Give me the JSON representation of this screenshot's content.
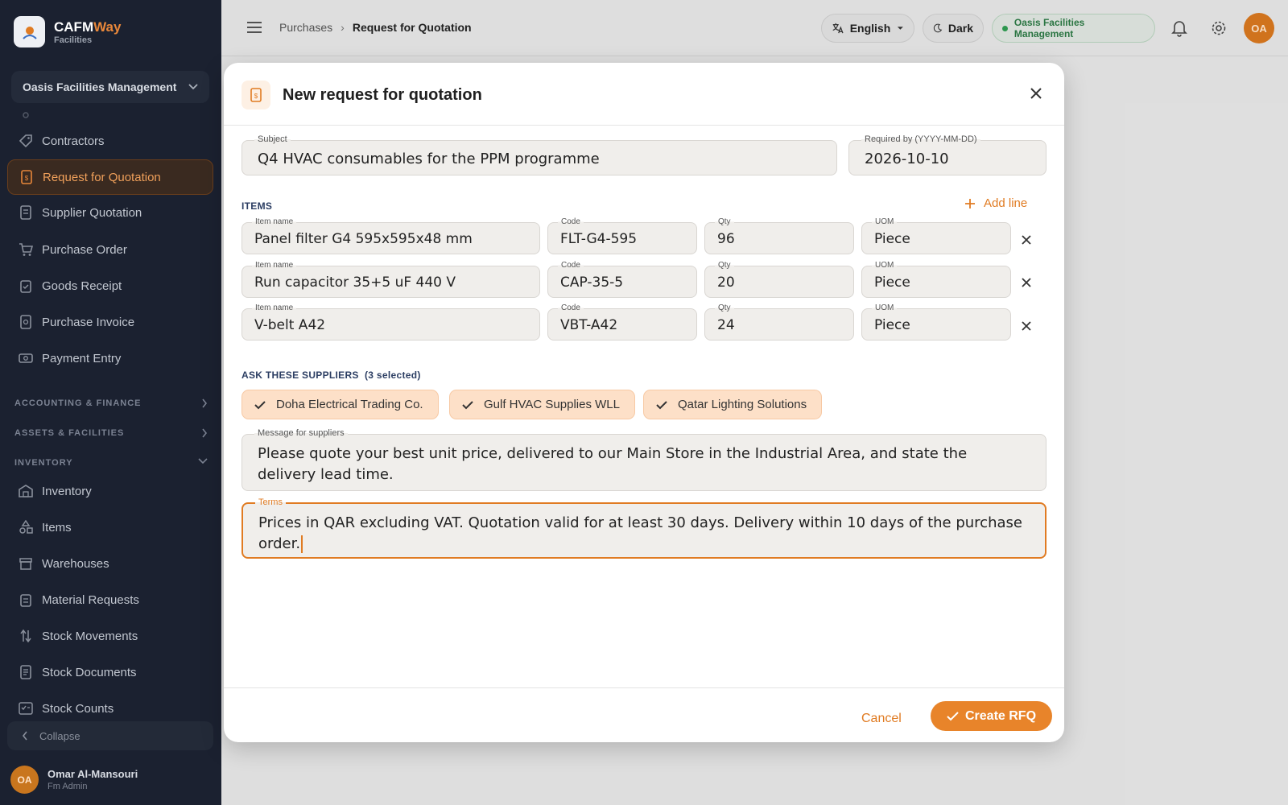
{
  "brand": {
    "name_a": "CAFM",
    "name_b": "Way",
    "sub": "Facilities"
  },
  "sidebar": {
    "org": "Oasis Facilities Management",
    "items": [
      {
        "label": "Contractors",
        "icon": "tag-icon"
      },
      {
        "label": "Request for Quotation",
        "icon": "document-icon",
        "active": true
      },
      {
        "label": "Supplier Quotation",
        "icon": "receipt-icon"
      },
      {
        "label": "Purchase Order",
        "icon": "cart-icon"
      },
      {
        "label": "Goods Receipt",
        "icon": "clipboard-icon"
      },
      {
        "label": "Purchase Invoice",
        "icon": "invoice-icon"
      },
      {
        "label": "Payment Entry",
        "icon": "cash-icon"
      }
    ],
    "sections": [
      "ACCOUNTING & FINANCE",
      "ASSETS & FACILITIES",
      "INVENTORY"
    ],
    "inventory_items": [
      {
        "label": "Inventory",
        "icon": "warehouse-icon"
      },
      {
        "label": "Items",
        "icon": "shapes-icon"
      },
      {
        "label": "Warehouses",
        "icon": "store-icon"
      },
      {
        "label": "Material Requests",
        "icon": "clipboard-list-icon"
      },
      {
        "label": "Stock Movements",
        "icon": "swap-icon"
      },
      {
        "label": "Stock Documents",
        "icon": "docs-icon"
      },
      {
        "label": "Stock Counts",
        "icon": "checklist-icon"
      }
    ],
    "collapse": "Collapse",
    "user": {
      "initials": "OA",
      "name": "Omar Al-Mansouri",
      "role": "Fm Admin"
    }
  },
  "topbar": {
    "breadcrumb": [
      "Purchases",
      "Request for Quotation"
    ],
    "language": "English",
    "theme": "Dark",
    "org": "Oasis Facilities Management",
    "avatar": "OA"
  },
  "modal": {
    "title": "New request for quotation",
    "subject": {
      "label": "Subject",
      "value": "Q4 HVAC consumables for the PPM programme"
    },
    "required_by": {
      "label": "Required by (YYYY-MM-DD)",
      "value": "2026-10-10"
    },
    "items_label": "ITEMS",
    "add_line": "Add line",
    "col_labels": {
      "name": "Item name",
      "code": "Code",
      "qty": "Qty",
      "uom": "UOM"
    },
    "lines": [
      {
        "name": "Panel filter G4 595x595x48 mm",
        "code": "FLT-G4-595",
        "qty": "96",
        "uom": "Piece"
      },
      {
        "name": "Run capacitor 35+5 uF 440 V",
        "code": "CAP-35-5",
        "qty": "20",
        "uom": "Piece"
      },
      {
        "name": "V-belt A42",
        "code": "VBT-A42",
        "qty": "24",
        "uom": "Piece"
      }
    ],
    "suppliers_label": "ASK THESE SUPPLIERS",
    "suppliers_count": "(3 selected)",
    "suppliers": [
      "Doha Electrical Trading Co.",
      "Gulf HVAC Supplies WLL",
      "Qatar Lighting Solutions"
    ],
    "message": {
      "label": "Message for suppliers",
      "value": "Please quote your best unit price, delivered to our Main Store in the Industrial Area, and state the delivery lead time."
    },
    "terms": {
      "label": "Terms",
      "value": "Prices in QAR excluding VAT. Quotation valid for at least 30 days. Delivery within 10 days of the purchase order."
    },
    "cancel": "Cancel",
    "create": "Create RFQ"
  },
  "colors": {
    "accent": "#e8842a",
    "sidebar_bg": "#1b2130",
    "org_green": "#2c7a45"
  }
}
